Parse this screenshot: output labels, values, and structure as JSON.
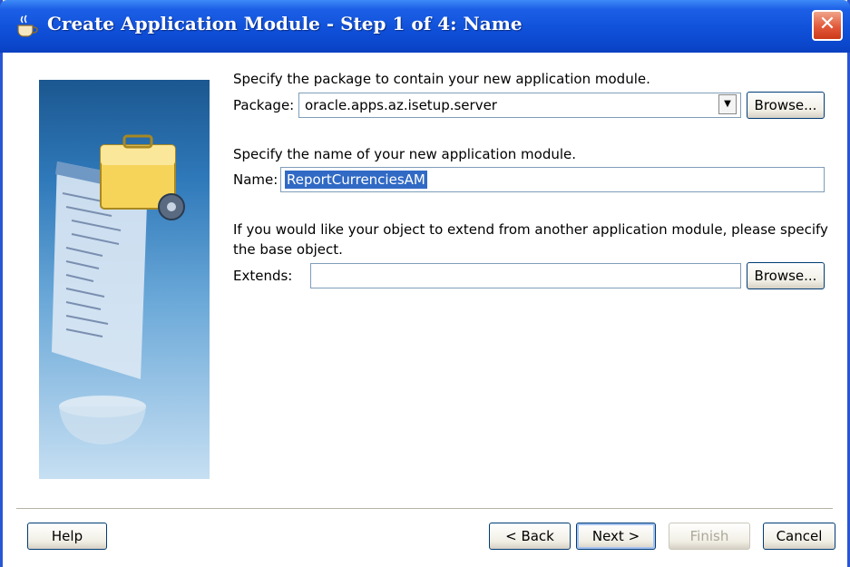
{
  "window": {
    "title": "Create Application Module - Step 1 of 4: Name"
  },
  "package": {
    "instruction": "Specify the package to contain your new application module.",
    "label": "Package:",
    "value": "oracle.apps.az.isetup.server",
    "browse_label": "Browse..."
  },
  "name": {
    "instruction": "Specify the name of your new application module.",
    "label": "Name:",
    "value": "ReportCurrenciesAM"
  },
  "extends": {
    "instruction_line1": "If you would like your object to extend from another application module, please specify",
    "instruction_line2": "the base object.",
    "label": "Extends:",
    "value": "",
    "browse_label": "Browse..."
  },
  "footer": {
    "help": "Help",
    "back": "< Back",
    "next": "Next >",
    "finish": "Finish",
    "cancel": "Cancel"
  },
  "icons": {
    "title": "coffee-cup-icon",
    "close": "close-icon",
    "dropdown": "chevron-down-icon"
  },
  "colors": {
    "title_bar": "#0b47cc",
    "selection": "#316ac5",
    "close_button": "#e2593a"
  }
}
